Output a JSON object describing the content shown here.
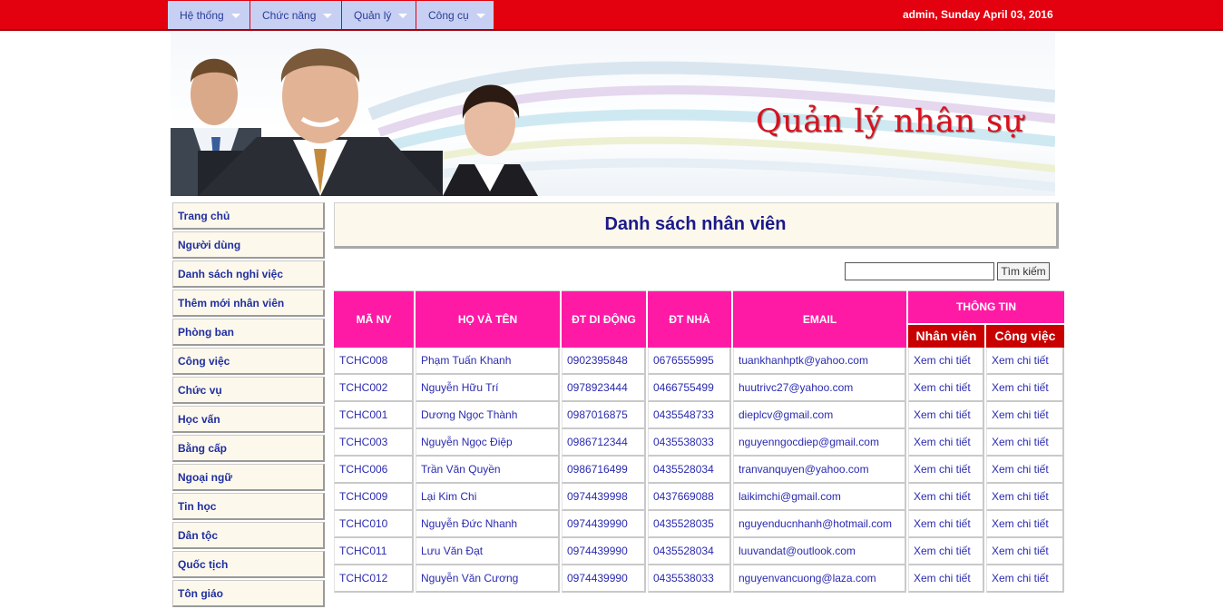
{
  "menu": [
    {
      "label": "Hệ thống"
    },
    {
      "label": "Chức năng"
    },
    {
      "label": "Quản lý"
    },
    {
      "label": "Công cụ"
    }
  ],
  "user_info": "admin, Sunday April 03, 2016",
  "banner": {
    "title": "Quản lý nhân sự"
  },
  "sidebar": [
    "Trang chủ",
    "Người dùng",
    "Danh sách nghỉ việc",
    "Thêm mới nhân viên",
    "Phòng ban",
    "Công việc",
    "Chức vụ",
    "Học vấn",
    "Bằng cấp",
    "Ngoại ngữ",
    "Tin học",
    "Dân tộc",
    "Quốc tịch",
    "Tôn giáo"
  ],
  "page_title": "Danh sách nhân viên",
  "search": {
    "value": "",
    "button": "Tìm kiếm"
  },
  "table": {
    "headers": {
      "id": "MÃ NV",
      "name": "HỌ VÀ TÊN",
      "mobile": "ĐT DI ĐỘNG",
      "home": "ĐT NHÀ",
      "email": "EMAIL",
      "info": "THÔNG TIN",
      "info_staff": "Nhân viên",
      "info_job": "Công việc"
    },
    "link_text": "Xem chi tiết",
    "rows": [
      {
        "id": "TCHC008",
        "name": "Phạm Tuấn Khanh",
        "mobile": "0902395848",
        "home": "0676555995",
        "email": "tuankhanhptk@yahoo.com"
      },
      {
        "id": "TCHC002",
        "name": "Nguyễn Hữu Trí",
        "mobile": "0978923444",
        "home": "0466755499",
        "email": "huutrivc27@yahoo.com"
      },
      {
        "id": "TCHC001",
        "name": "Dương Ngọc Thành",
        "mobile": "0987016875",
        "home": "0435548733",
        "email": "dieplcv@gmail.com"
      },
      {
        "id": "TCHC003",
        "name": "Nguyễn Ngọc Điệp",
        "mobile": "0986712344",
        "home": "0435538033",
        "email": "nguyenngocdiep@gmail.com"
      },
      {
        "id": "TCHC006",
        "name": "Trần Văn Quyền",
        "mobile": "0986716499",
        "home": "0435528034",
        "email": "tranvanquyen@yahoo.com"
      },
      {
        "id": "TCHC009",
        "name": "Lại Kim Chi",
        "mobile": "0974439998",
        "home": "0437669088",
        "email": "laikimchi@gmail.com"
      },
      {
        "id": "TCHC010",
        "name": "Nguyễn Đức Nhanh",
        "mobile": "0974439990",
        "home": "0435528035",
        "email": "nguyenducnhanh@hotmail.com"
      },
      {
        "id": "TCHC011",
        "name": "Lưu Văn Đạt",
        "mobile": "0974439990",
        "home": "0435528034",
        "email": "luuvandat@outlook.com"
      },
      {
        "id": "TCHC012",
        "name": "Nguyễn Văn Cương",
        "mobile": "0974439990",
        "home": "0435538033",
        "email": "nguyenvancuong@laza.com"
      }
    ]
  },
  "colors": {
    "topbar": "#e3000f",
    "menu_bg": "#c7d0f2",
    "header_pink": "#ff1aa6",
    "header_red": "#c80000",
    "panel_cream": "#fdf8ec",
    "link_blue": "#2a2ab0"
  }
}
